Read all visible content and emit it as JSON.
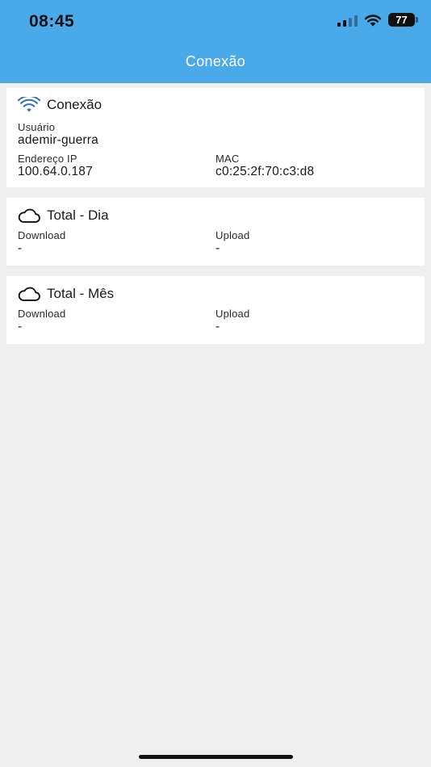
{
  "status_bar": {
    "time": "08:45",
    "battery": "77"
  },
  "header": {
    "title": "Conexão"
  },
  "connection_card": {
    "title": "Conexão",
    "icon": "wifi-icon",
    "user_label": "Usuário",
    "user_value": "ademir-guerra",
    "ip_label": "Endereço IP",
    "ip_value": "100.64.0.187",
    "mac_label": "MAC",
    "mac_value": "c0:25:2f:70:c3:d8"
  },
  "day_card": {
    "title": "Total - Dia",
    "icon": "cloud-icon",
    "download_label": "Download",
    "download_value": "-",
    "upload_label": "Upload",
    "upload_value": "-"
  },
  "month_card": {
    "title": "Total - Mês",
    "icon": "cloud-icon",
    "download_label": "Download",
    "download_value": "-",
    "upload_label": "Upload",
    "upload_value": "-"
  },
  "colors": {
    "header": "#4aa9e9",
    "background": "#efefef",
    "wifi_icon": "#2b6fc0"
  }
}
